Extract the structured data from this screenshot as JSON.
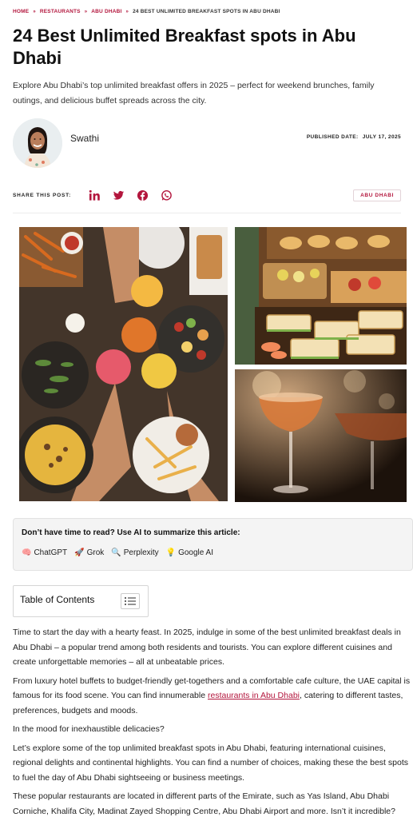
{
  "breadcrumb": {
    "items": [
      "HOME",
      "RESTAURANTS",
      "ABU DHABI",
      "24 BEST UNLIMITED BREAKFAST SPOTS IN ABU DHABI"
    ],
    "separator": "»"
  },
  "article": {
    "title": "24 Best Unlimited Breakfast spots in Abu Dhabi",
    "intro": "Explore Abu Dhabi’s top unlimited breakfast offers in 2025 – perfect for weekend brunches, family outings, and delicious buffet spreads across the city."
  },
  "author": {
    "name": "Swathi",
    "published_label": "PUBLISHED DATE:",
    "published_date": "JULY 17, 2025"
  },
  "share": {
    "label": "SHARE THIS POST:",
    "icons": [
      "linkedin-icon",
      "twitter-icon",
      "facebook-icon",
      "whatsapp-icon"
    ],
    "tag": "ABU DHABI"
  },
  "ai_summary": {
    "heading": "Don’t have time to read? Use AI to summarize this article:",
    "links": [
      {
        "glyph": "🧠",
        "label": "ChatGPT"
      },
      {
        "glyph": "🚀",
        "label": "Grok"
      },
      {
        "glyph": "🔍",
        "label": "Perplexity"
      },
      {
        "glyph": "💡",
        "label": "Google AI"
      }
    ]
  },
  "toc": {
    "title": "Table of Contents"
  },
  "body": {
    "p1": "Time to start the day with a hearty feast. In 2025, indulge in some of the best unlimited breakfast deals in Abu Dhabi – a popular trend among both residents and tourists. You can explore different cuisines and create unforgettable memories – all at unbeatable prices.",
    "p2_before": "From luxury hotel buffets to budget-friendly get-togethers and a comfortable cafe culture, the UAE capital is famous for its food scene. You can find innumerable ",
    "p2_link": "restaurants in Abu Dhabi",
    "p2_after": ", catering to different tastes, preferences, budgets and moods.",
    "p3": "In the mood for inexhaustible delicacies?",
    "p4": "Let’s explore some of the top unlimited breakfast spots in Abu Dhabi, featuring international cuisines, regional delights and continental highlights. You can find a number of choices, making these the best spots to fuel the day of Abu Dhabi sightseeing or business meetings.",
    "p5": "These popular restaurants are located in different parts of the Emirate, such as Yas Island, Abu Dhabi Corniche, Khalifa City, Madinat Zayed Shopping Centre, Abu Dhabi Airport and more. Isn’t it incredible?"
  },
  "colors": {
    "accent": "#b3163d",
    "text": "#222222"
  }
}
